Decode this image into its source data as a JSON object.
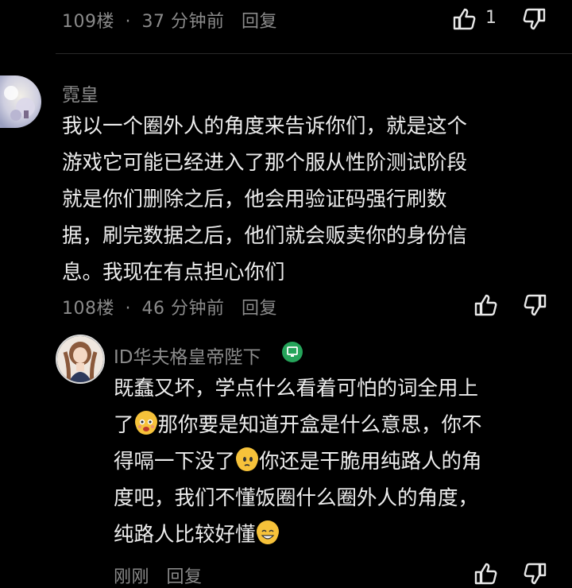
{
  "comments": [
    {
      "floor": "109楼",
      "time": "37 分钟前",
      "reply": "回复",
      "likes": "1"
    },
    {
      "author": "霓皇",
      "lines": [
        "我以一个圈外人的角度来告诉你们，就是这个",
        "游戏它可能已经进入了那个服从性阶测试阶段",
        "就是你们删除之后，他会用验证码强行刷数",
        "据，刷完数据之后，他们就会贩卖你的身份信",
        "息。我现在有点担心你们"
      ],
      "floor": "108楼",
      "time": "46 分钟前",
      "reply": "回复"
    }
  ],
  "reply_comment": {
    "author": "ID华夫格皇帝陛下",
    "line1": "既蠢又坏，学点什么看着可怕的词全用上",
    "line2a": "了",
    "line2b": "那你要是知道开盒是什么意思，你不",
    "line3a": "得嗝一下没了",
    "line3b": "你还是干脆用纯路人的角",
    "line4": "度吧，我们不懂饭圈什么圈外人的角度，",
    "line5": "纯路人比较好懂",
    "floor": "刚刚",
    "reply": "回复"
  },
  "icons": {
    "like": "thumbs-up-icon",
    "dislike": "thumbs-down-icon",
    "badge": "monitor-badge-icon",
    "emoji": [
      "shocked-face-emoji",
      "side-eye-face-emoji",
      "grin-face-emoji"
    ]
  },
  "colors": {
    "background": "#000000",
    "text": "#ededed",
    "meta": "#8a8a8a",
    "badge": "#25a45a"
  }
}
